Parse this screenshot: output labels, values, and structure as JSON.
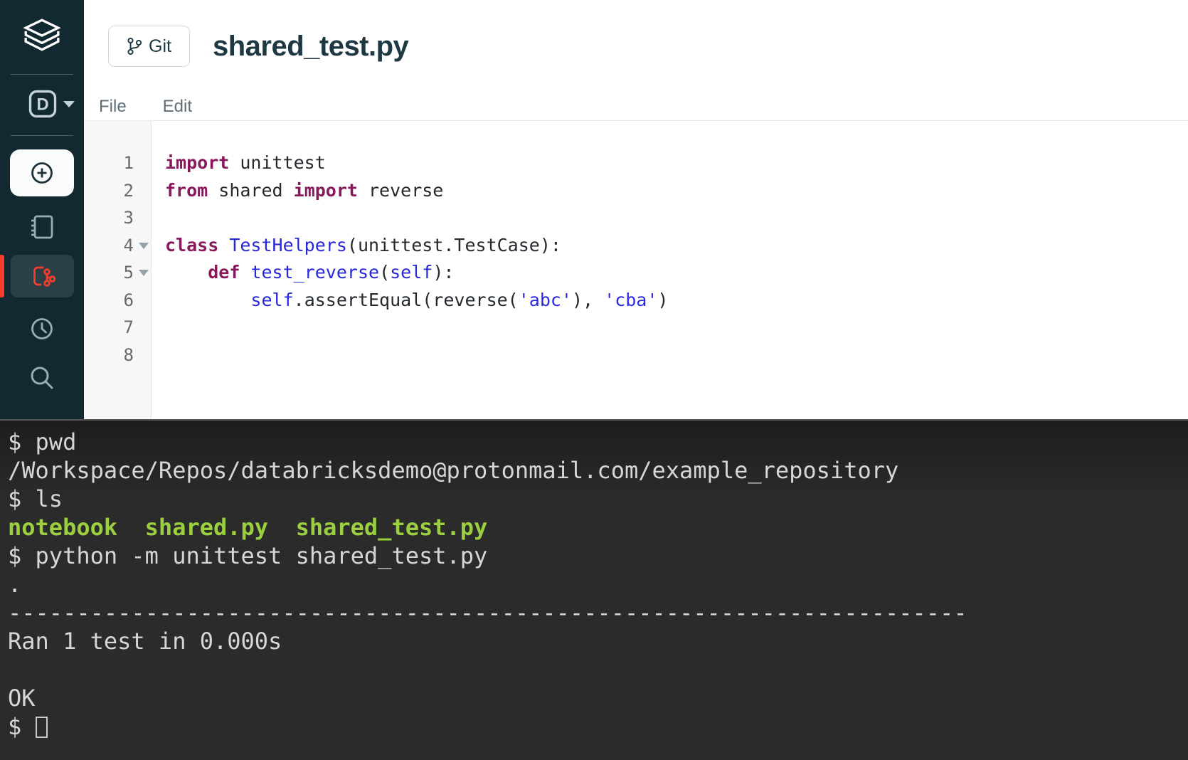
{
  "colors": {
    "keyword": "#871A5C",
    "identifier": "#2727DB",
    "string": "#2B2BE0",
    "terminal_green": "#9BCF3F",
    "accent_red": "#F93B2B",
    "sidebar_bg": "#122931"
  },
  "sidebar": {
    "workspace_letter": "D",
    "icons": [
      "databricks-logo",
      "workspace-switcher",
      "new-plus",
      "notebook",
      "repos",
      "recents-clock",
      "search"
    ]
  },
  "header": {
    "git_button_label": "Git",
    "title": "shared_test.py"
  },
  "menu": {
    "items": [
      "File",
      "Edit"
    ]
  },
  "editor": {
    "lines": [
      {
        "n": "1",
        "fold": false,
        "tokens": [
          [
            "kw",
            "import"
          ],
          [
            "pl",
            " unittest"
          ]
        ]
      },
      {
        "n": "2",
        "fold": false,
        "tokens": [
          [
            "kw",
            "from"
          ],
          [
            "pl",
            " shared "
          ],
          [
            "kw",
            "import"
          ],
          [
            "pl",
            " reverse"
          ]
        ]
      },
      {
        "n": "3",
        "fold": false,
        "tokens": []
      },
      {
        "n": "4",
        "fold": true,
        "tokens": [
          [
            "kw",
            "class"
          ],
          [
            "pl",
            " "
          ],
          [
            "id",
            "TestHelpers"
          ],
          [
            "pl",
            "(unittest.TestCase):"
          ]
        ]
      },
      {
        "n": "5",
        "fold": true,
        "tokens": [
          [
            "pl",
            "    "
          ],
          [
            "kw",
            "def"
          ],
          [
            "pl",
            " "
          ],
          [
            "id",
            "test_reverse"
          ],
          [
            "pl",
            "("
          ],
          [
            "id",
            "self"
          ],
          [
            "pl",
            "):"
          ]
        ]
      },
      {
        "n": "6",
        "fold": false,
        "tokens": [
          [
            "pl",
            "        "
          ],
          [
            "id",
            "self"
          ],
          [
            "pl",
            ".assertEqual(reverse("
          ],
          [
            "st",
            "'abc'"
          ],
          [
            "pl",
            "), "
          ],
          [
            "st",
            "'cba'"
          ],
          [
            "pl",
            ")"
          ]
        ]
      },
      {
        "n": "7",
        "fold": false,
        "tokens": []
      },
      {
        "n": "8",
        "fold": false,
        "tokens": []
      }
    ]
  },
  "terminal": {
    "lines": [
      {
        "segs": [
          [
            "pr",
            "$ "
          ],
          [
            "pl",
            "pwd"
          ]
        ]
      },
      {
        "segs": [
          [
            "pl",
            "/Workspace/Repos/databricksdemo@protonmail.com/example_repository"
          ]
        ]
      },
      {
        "segs": [
          [
            "pr",
            "$ "
          ],
          [
            "pl",
            "ls"
          ]
        ]
      },
      {
        "segs": [
          [
            "dir",
            "notebook"
          ],
          [
            "pl",
            "  "
          ],
          [
            "dir",
            "shared.py"
          ],
          [
            "pl",
            "  "
          ],
          [
            "dir",
            "shared_test.py"
          ]
        ]
      },
      {
        "segs": [
          [
            "pr",
            "$ "
          ],
          [
            "pl",
            "python -m unittest shared_test.py"
          ]
        ]
      },
      {
        "segs": [
          [
            "pl",
            "."
          ]
        ]
      },
      {
        "segs": [
          [
            "pl",
            "----------------------------------------------------------------------"
          ]
        ]
      },
      {
        "segs": [
          [
            "pl",
            "Ran 1 test in 0.000s"
          ]
        ]
      },
      {
        "segs": []
      },
      {
        "segs": [
          [
            "pl",
            "OK"
          ]
        ]
      },
      {
        "segs": [
          [
            "pr",
            "$ "
          ]
        ],
        "cursor": true
      }
    ]
  }
}
